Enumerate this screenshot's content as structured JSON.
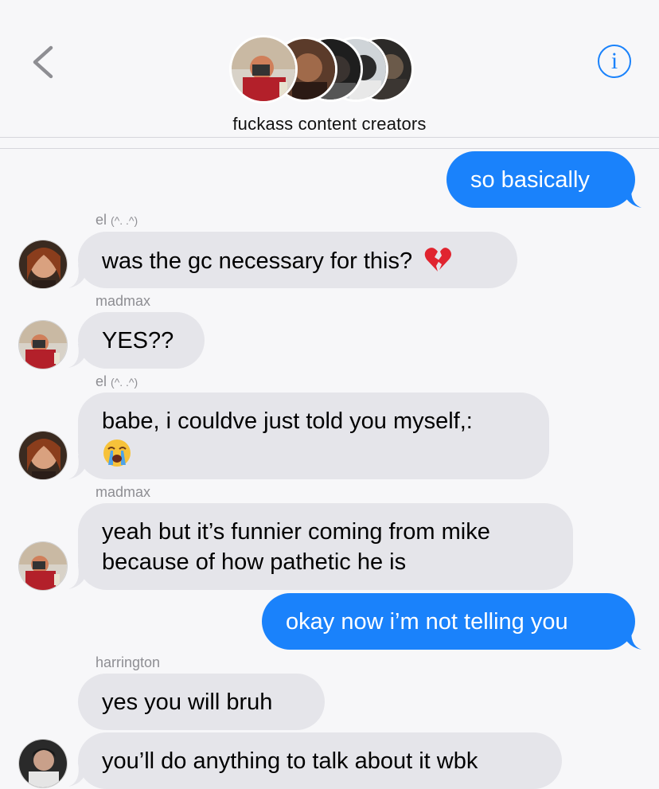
{
  "header": {
    "title": "fuckass content creators",
    "info_label": "i"
  },
  "colors": {
    "accent": "#1a82fb",
    "incoming_bubble": "#e5e5ea",
    "background": "#f7f7f9",
    "sender_gray": "#8e8e93"
  },
  "icons": {
    "back": "chevron-left-icon",
    "info": "info-icon",
    "broken_heart": "broken-heart-emoji",
    "crying": "loudly-crying-emoji"
  },
  "messages": [
    {
      "type": "outgoing",
      "text": "so basically"
    },
    {
      "type": "sender",
      "text": "el",
      "suffix": "(^. .^)"
    },
    {
      "type": "incoming",
      "text": "was the gc necessary for this?"
    },
    {
      "type": "sender",
      "text": "madmax"
    },
    {
      "type": "incoming",
      "text": "YES??"
    },
    {
      "type": "sender",
      "text": "el",
      "suffix": "(^. .^)"
    },
    {
      "type": "incoming",
      "text": "babe, i couldve just told you myself,:"
    },
    {
      "type": "sender",
      "text": "madmax"
    },
    {
      "type": "incoming",
      "text": "yeah but it’s funnier coming from mike",
      "text2": "because of how pathetic he is"
    },
    {
      "type": "outgoing",
      "text": "okay now i’m not telling you"
    },
    {
      "type": "sender",
      "text": "harrington"
    },
    {
      "type": "incoming",
      "text": "yes you will bruh"
    },
    {
      "type": "incoming",
      "text": "you’ll do anything to talk about it wbk"
    }
  ]
}
